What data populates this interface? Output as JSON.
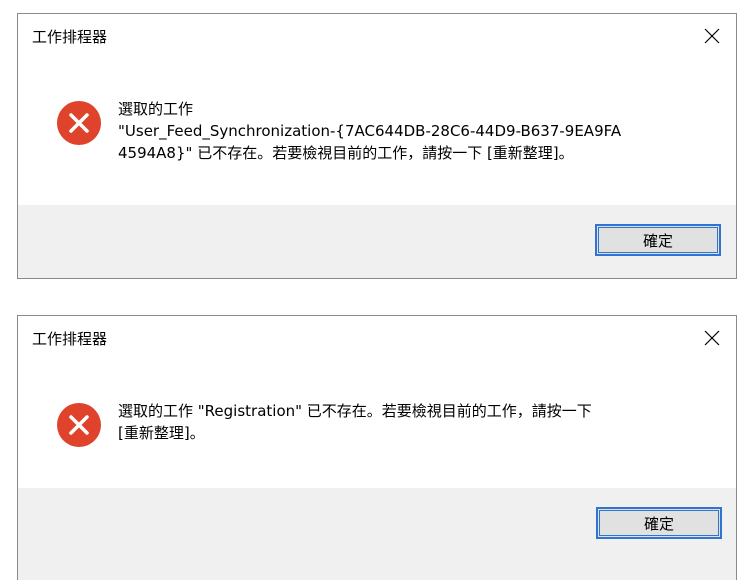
{
  "dialogs": [
    {
      "title": "工作排程器",
      "message_lines": [
        "選取的工作",
        "\"User_Feed_Synchronization-{7AC644DB-28C6-44D9-B637-9EA9FA",
        "4594A8}\" 已不存在。若要檢視目前的工作，請按一下 [重新整理]。"
      ],
      "ok_label": "確定",
      "icon": "error-icon"
    },
    {
      "title": "工作排程器",
      "message_lines": [
        "選取的工作 \"Registration\" 已不存在。若要檢視目前的工作，請按一下",
        "[重新整理]。"
      ],
      "ok_label": "確定",
      "icon": "error-icon"
    }
  ],
  "colors": {
    "error_red": "#e0432b",
    "footer_bg": "#f0f0f0",
    "button_border": "#2f74d0",
    "button_bg": "#e1e1e1"
  }
}
